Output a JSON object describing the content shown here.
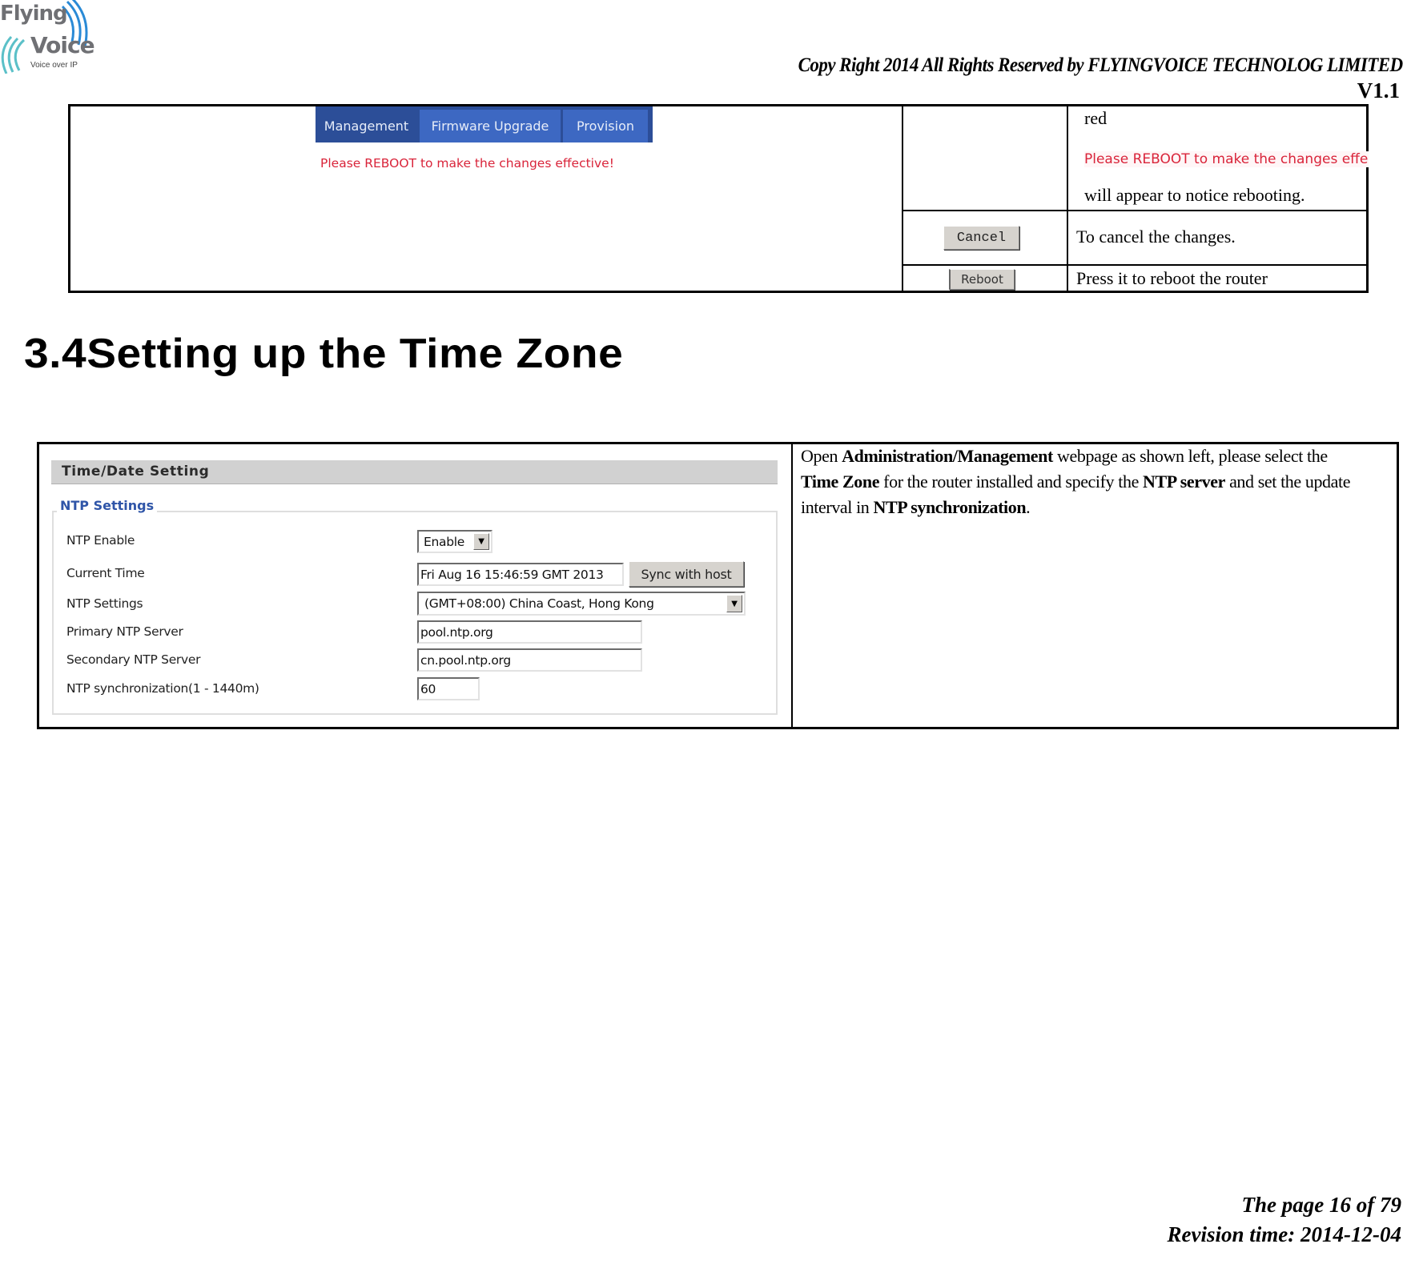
{
  "header": {
    "logo": {
      "line1": "Flying",
      "line2": "Voice",
      "tagline": "Voice over IP"
    },
    "copyright": "Copy Right 2014 All Rights Reserved by FLYINGVOICE TECHNOLOG LIMITED",
    "version": "V1.1"
  },
  "top_table": {
    "screenshot": {
      "tabs": [
        {
          "label": "Management",
          "active": true
        },
        {
          "label": "Firmware Upgrade",
          "active": false
        },
        {
          "label": "Provision",
          "active": false
        }
      ],
      "reboot_message": "Please REBOOT to make the changes effective!"
    },
    "rows": [
      {
        "desc_line1": "red",
        "desc_message": "Please REBOOT to make the changes effective!",
        "desc_line2": "will appear to notice rebooting."
      },
      {
        "button_label": "Cancel",
        "description": "To cancel the changes."
      },
      {
        "button_label": "Reboot",
        "description": "Press it to reboot the router"
      }
    ]
  },
  "section": {
    "heading": "3.4Setting up the Time Zone"
  },
  "time_panel": {
    "title": "Time/Date Setting",
    "group_legend": "NTP Settings",
    "fields": [
      {
        "label": "NTP Enable",
        "value": "Enable",
        "type": "select"
      },
      {
        "label": "Current Time",
        "value": "Fri Aug 16 15:46:59 GMT 2013",
        "type": "text",
        "button": "Sync with host"
      },
      {
        "label": "NTP Settings",
        "value": "(GMT+08:00) China Coast, Hong Kong",
        "type": "select"
      },
      {
        "label": "Primary NTP Server",
        "value": "pool.ntp.org",
        "type": "text"
      },
      {
        "label": "Secondary NTP Server",
        "value": "cn.pool.ntp.org",
        "type": "text"
      },
      {
        "label": "NTP synchronization(1 - 1440m)",
        "value": "60",
        "type": "text"
      }
    ]
  },
  "description": {
    "t1": "Open ",
    "b1": "Administration/Management",
    "t2": " webpage as shown left, please select the ",
    "b2": "Time Zone",
    "t3": " for the router installed and specify the ",
    "b3": "NTP server",
    "t4": " and set the update interval in ",
    "b4": "NTP synchronization",
    "t5": "."
  },
  "footer": {
    "page": "The page 16 of 79",
    "revision": "Revision time: 2014-12-04"
  },
  "colors": {
    "tab_active": "#2c4e98",
    "tab_inactive": "#3d68c2",
    "warning_red": "#d9243a",
    "legend_blue": "#2f55a8",
    "panel_header_gray": "#d1d1d1"
  }
}
